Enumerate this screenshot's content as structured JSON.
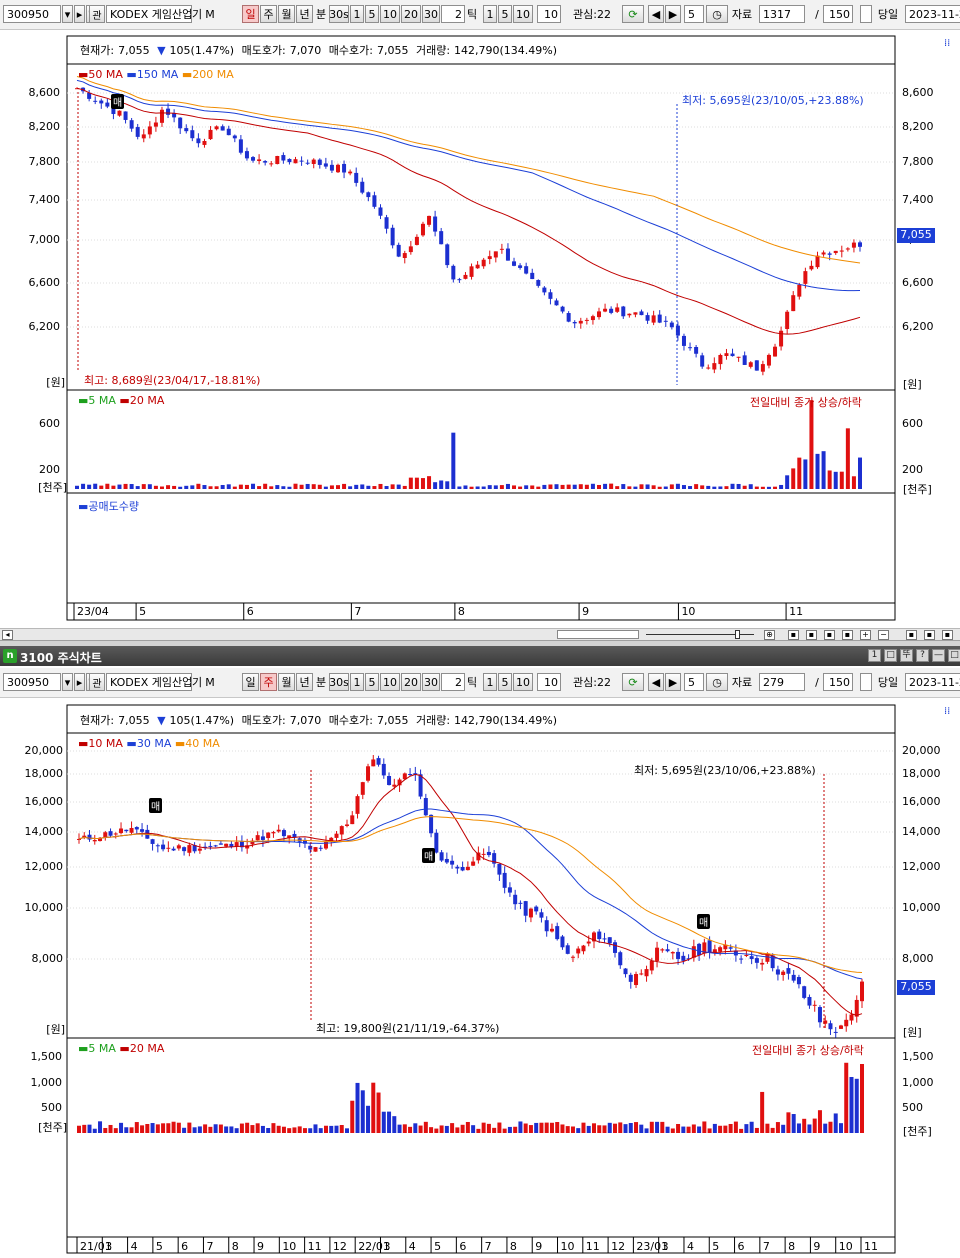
{
  "top": {
    "toolbar": {
      "code": "300950",
      "name": "KODEX 게임산업",
      "name_suffix1": "기",
      "name_suffix2": "M",
      "search": "🔍",
      "prev": "▸",
      "gwan": "관",
      "periods": [
        "일",
        "주",
        "월",
        "년",
        "분",
        "30s"
      ],
      "mins": [
        "1",
        "5",
        "10",
        "20",
        "30"
      ],
      "tick_count": "2",
      "tick_label": "틱",
      "ticks": [
        "1",
        "5",
        "10"
      ],
      "ten": "10",
      "interest": "관심:22",
      "step": "5",
      "data_label": "자료",
      "data_count": "1317",
      "slash": "/",
      "count": "150",
      "today_label": "당일",
      "date": "2023-11-2"
    },
    "info": {
      "cur_label": "현재가:",
      "cur": "7,055",
      "change": "105(1.47%)",
      "ask_label": "매도호가:",
      "ask": "7,070",
      "bid_label": "매수호가:",
      "bid": "7,055",
      "vol_label": "거래량:",
      "vol": "142,790(134.49%)"
    },
    "legend": [
      "50 MA",
      "150 MA",
      "200 MA"
    ],
    "legend_colors": [
      "#c00000",
      "#1c3fd6",
      "#f08c00"
    ],
    "price_axis": [
      "8,600",
      "8,200",
      "7,800",
      "7,400",
      "7,000",
      "6,600",
      "6,200"
    ],
    "price_unit": "[원]",
    "last_price": "7,055",
    "low_note": "최저: 5,695원(23/10/05,+23.88%)",
    "high_note": "최고: 8,689원(23/04/17,-18.81%)",
    "buy_mark": "매",
    "vol_legend": [
      "5 MA",
      "20 MA"
    ],
    "vol_colors": [
      "#1ea01e",
      "#c00000"
    ],
    "vol_note": "전일대비 종가 상승/하락",
    "vol_axis": [
      "600",
      "200"
    ],
    "vol_unit": "[천주]",
    "short_label": "공매도수량",
    "x_axis": [
      "23/04",
      "5",
      "6",
      "7",
      "8",
      "9",
      "10",
      "11"
    ],
    "x_pos": [
      0,
      0.075,
      0.205,
      0.335,
      0.46,
      0.61,
      0.73,
      0.86
    ]
  },
  "window_title": "3100 주식차트",
  "window_buttons": [
    "1",
    "□",
    "뚜",
    "?",
    "—",
    "□",
    "×"
  ],
  "bottom": {
    "toolbar": {
      "code": "300950",
      "name": "KODEX 게임산업",
      "name_suffix1": "기",
      "name_suffix2": "M",
      "search": "🔍",
      "prev": "▸",
      "gwan": "관",
      "periods": [
        "일",
        "주",
        "월",
        "년",
        "분",
        "30s"
      ],
      "mins": [
        "1",
        "5",
        "10",
        "20",
        "30"
      ],
      "tick_count": "2",
      "tick_label": "틱",
      "ticks": [
        "1",
        "5",
        "10"
      ],
      "ten": "10",
      "interest": "관심:22",
      "step": "5",
      "data_label": "자료",
      "data_count": "279",
      "slash": "/",
      "count": "150",
      "today_label": "당일",
      "date": "2023-11-2"
    },
    "info": {
      "cur_label": "현재가:",
      "cur": "7,055",
      "change": "105(1.47%)",
      "ask_label": "매도호가:",
      "ask": "7,070",
      "bid_label": "매수호가:",
      "bid": "7,055",
      "vol_label": "거래량:",
      "vol": "142,790(134.49%)"
    },
    "legend": [
      "10 MA",
      "30 MA",
      "40 MA"
    ],
    "legend_colors": [
      "#c00000",
      "#1c3fd6",
      "#f08c00"
    ],
    "price_axis": [
      "20,000",
      "18,000",
      "16,000",
      "14,000",
      "12,000",
      "10,000",
      "8,000"
    ],
    "price_unit": "[원]",
    "last_price": "7,055",
    "low_note": "최저: 5,695원(23/10/06,+23.88%)",
    "high_note": "최고: 19,800원(21/11/19,-64.37%)",
    "buy_mark": "매",
    "vol_legend": [
      "5 MA",
      "20 MA"
    ],
    "vol_colors": [
      "#1ea01e",
      "#c00000"
    ],
    "vol_note": "전일대비 종가 상승/하락",
    "vol_axis": [
      "1,500",
      "1,000",
      "500"
    ],
    "vol_unit": "[천주]",
    "x_axis": [
      "21/01",
      "3",
      "4",
      "5",
      "6",
      "7",
      "8",
      "9",
      "10",
      "11",
      "12",
      "22/01",
      "3",
      "4",
      "5",
      "6",
      "7",
      "8",
      "9",
      "10",
      "11",
      "12",
      "23/01",
      "3",
      "4",
      "5",
      "6",
      "7",
      "8",
      "9",
      "10",
      "11"
    ]
  }
}
